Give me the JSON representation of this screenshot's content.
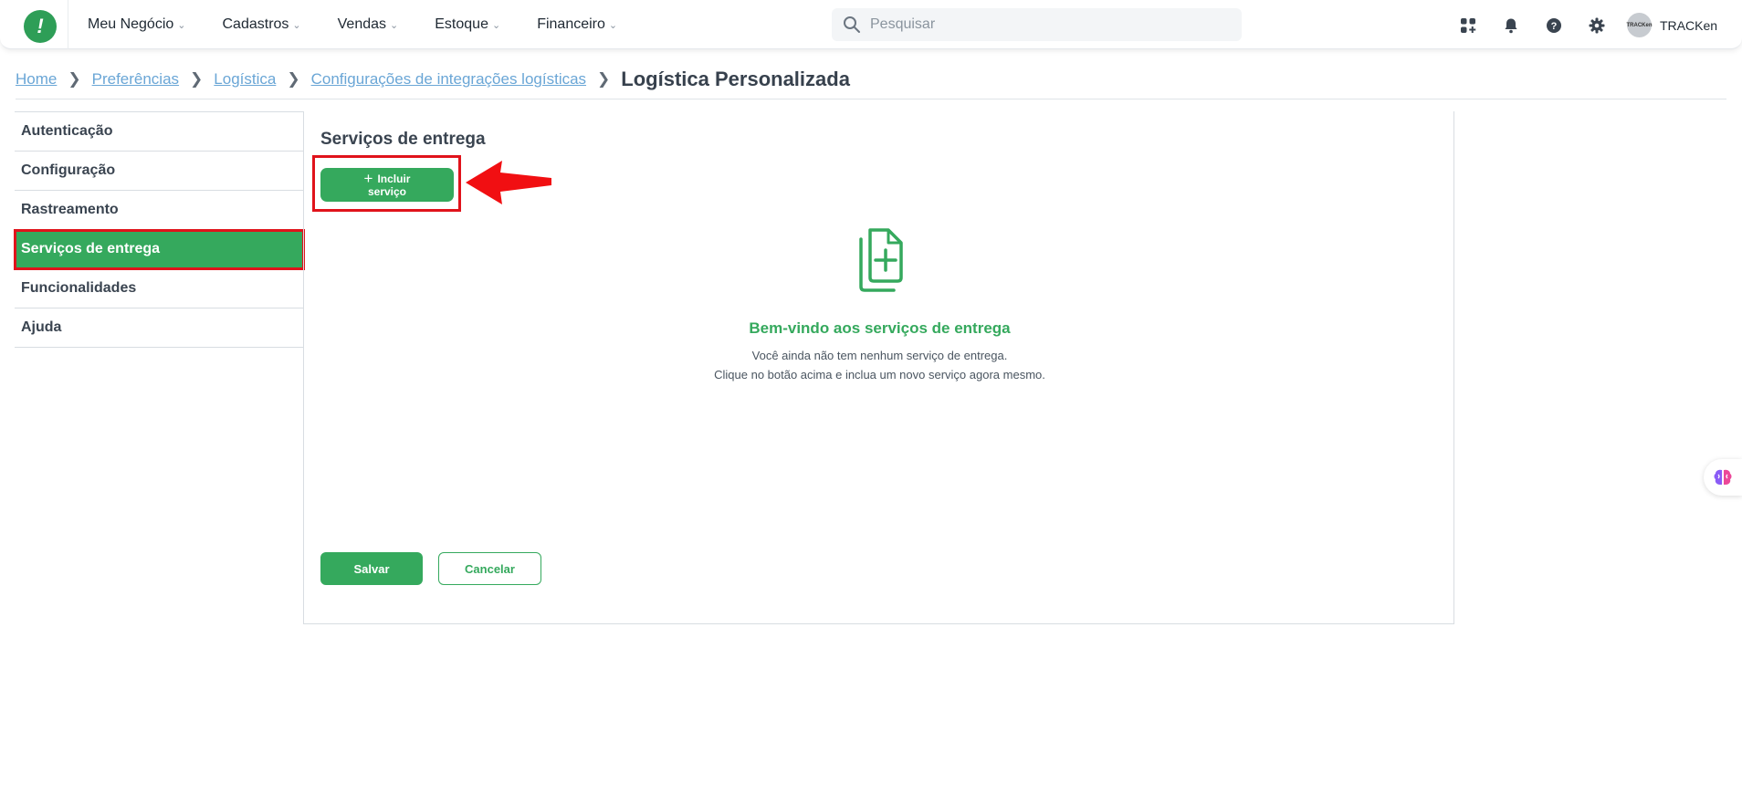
{
  "topbar": {
    "logo_glyph": "!",
    "nav": [
      {
        "label": "Meu Negócio"
      },
      {
        "label": "Cadastros"
      },
      {
        "label": "Vendas"
      },
      {
        "label": "Estoque"
      },
      {
        "label": "Financeiro"
      }
    ],
    "search": {
      "placeholder": "Pesquisar"
    },
    "icons": [
      "apps-icon",
      "bell-icon",
      "help-icon",
      "gear-icon"
    ],
    "user": {
      "name": "TRACKen",
      "avatar_text": "TRACKen"
    }
  },
  "breadcrumb": {
    "links": [
      "Home",
      "Preferências",
      "Logística",
      "Configurações de integrações logísticas"
    ],
    "current": "Logística Personalizada"
  },
  "sidebar": {
    "items": [
      {
        "label": "Autenticação",
        "active": false
      },
      {
        "label": "Configuração",
        "active": false
      },
      {
        "label": "Rastreamento",
        "active": false
      },
      {
        "label": "Serviços de entrega",
        "active": true
      },
      {
        "label": "Funcionalidades",
        "active": false
      },
      {
        "label": "Ajuda",
        "active": false
      }
    ]
  },
  "main": {
    "title": "Serviços de entrega",
    "add_button_line1": "Incluir",
    "add_button_line2": "serviço",
    "empty": {
      "title": "Bem-vindo aos serviços de entrega",
      "line1": "Você ainda não tem nenhum serviço de entrega.",
      "line2": "Clique no botão acima e inclua um novo serviço agora mesmo."
    },
    "save_label": "Salvar",
    "cancel_label": "Cancelar"
  },
  "colors": {
    "brand_green": "#35a95d",
    "highlight_red": "#e0131b",
    "link_blue": "#6aa6d6"
  }
}
